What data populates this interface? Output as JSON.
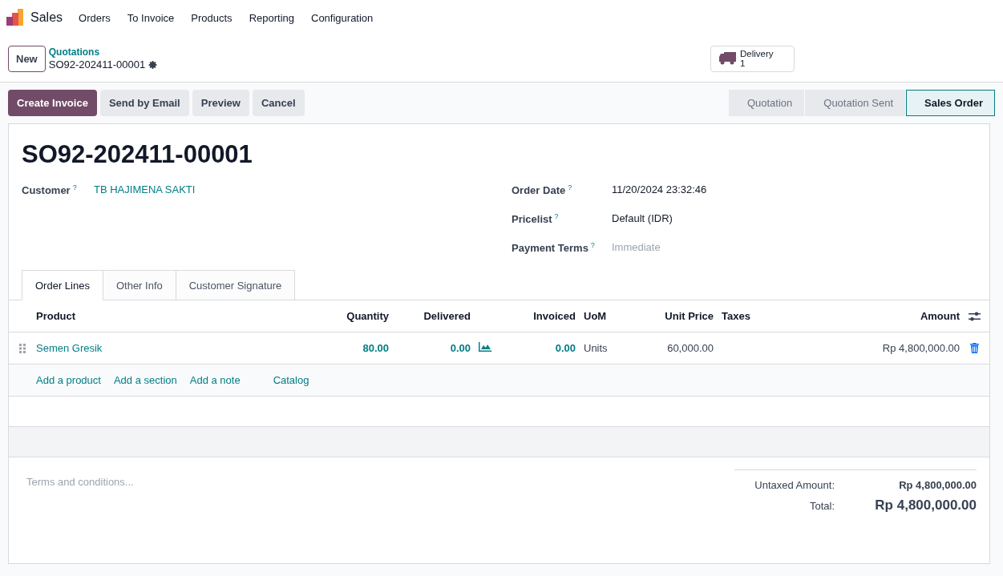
{
  "nav": {
    "app": "Sales",
    "menu": [
      "Orders",
      "To Invoice",
      "Products",
      "Reporting",
      "Configuration"
    ]
  },
  "control": {
    "new_button": "New",
    "breadcrumb": "Quotations",
    "record": "SO92-202411-00001",
    "smart_button": {
      "label": "Delivery",
      "count": "1"
    }
  },
  "actions": [
    {
      "label": "Create Invoice",
      "kind": "primary"
    },
    {
      "label": "Send by Email",
      "kind": "secondary"
    },
    {
      "label": "Preview",
      "kind": "secondary"
    },
    {
      "label": "Cancel",
      "kind": "secondary"
    }
  ],
  "statusbar": [
    {
      "label": "Quotation",
      "selected": false
    },
    {
      "label": "Quotation Sent",
      "selected": false
    },
    {
      "label": "Sales Order",
      "selected": true
    }
  ],
  "form": {
    "title": "SO92-202411-00001",
    "left_fields": [
      {
        "label": "Customer",
        "help": "?",
        "value": "TB HAJIMENA SAKTI",
        "kind": "link"
      }
    ],
    "right_fields": [
      {
        "label": "Order Date",
        "help": "?",
        "value": "11/20/2024 23:32:46",
        "kind": "text"
      },
      {
        "label": "Pricelist",
        "help": "?",
        "value": "Default (IDR)",
        "kind": "text"
      },
      {
        "label": "Payment Terms",
        "help": "?",
        "placeholder": "Immediate",
        "kind": "input"
      }
    ]
  },
  "tabs": [
    {
      "label": "Order Lines",
      "selected": true
    },
    {
      "label": "Other Info",
      "selected": false
    },
    {
      "label": "Customer Signature",
      "selected": false
    }
  ],
  "table": {
    "columns": [
      "Product",
      "Quantity",
      "Delivered",
      "Invoiced",
      "UoM",
      "Unit Price",
      "Taxes",
      "Amount"
    ],
    "rows": [
      {
        "product": "Semen Gresik",
        "quantity": "80.00",
        "delivered": "0.00",
        "invoiced": "0.00",
        "uom": "Units",
        "unit_price": "60,000.00",
        "amount": "Rp 4,800,000.00"
      }
    ],
    "add_links": [
      "Add a product",
      "Add a section",
      "Add a note",
      "Catalog"
    ]
  },
  "terms": {
    "placeholder": "Terms and conditions..."
  },
  "totals": [
    {
      "label": "Untaxed Amount:",
      "value": "Rp 4,800,000.00",
      "kind": "subtotal"
    },
    {
      "label": "Total:",
      "value": "Rp 4,800,000.00",
      "kind": "total"
    }
  ]
}
